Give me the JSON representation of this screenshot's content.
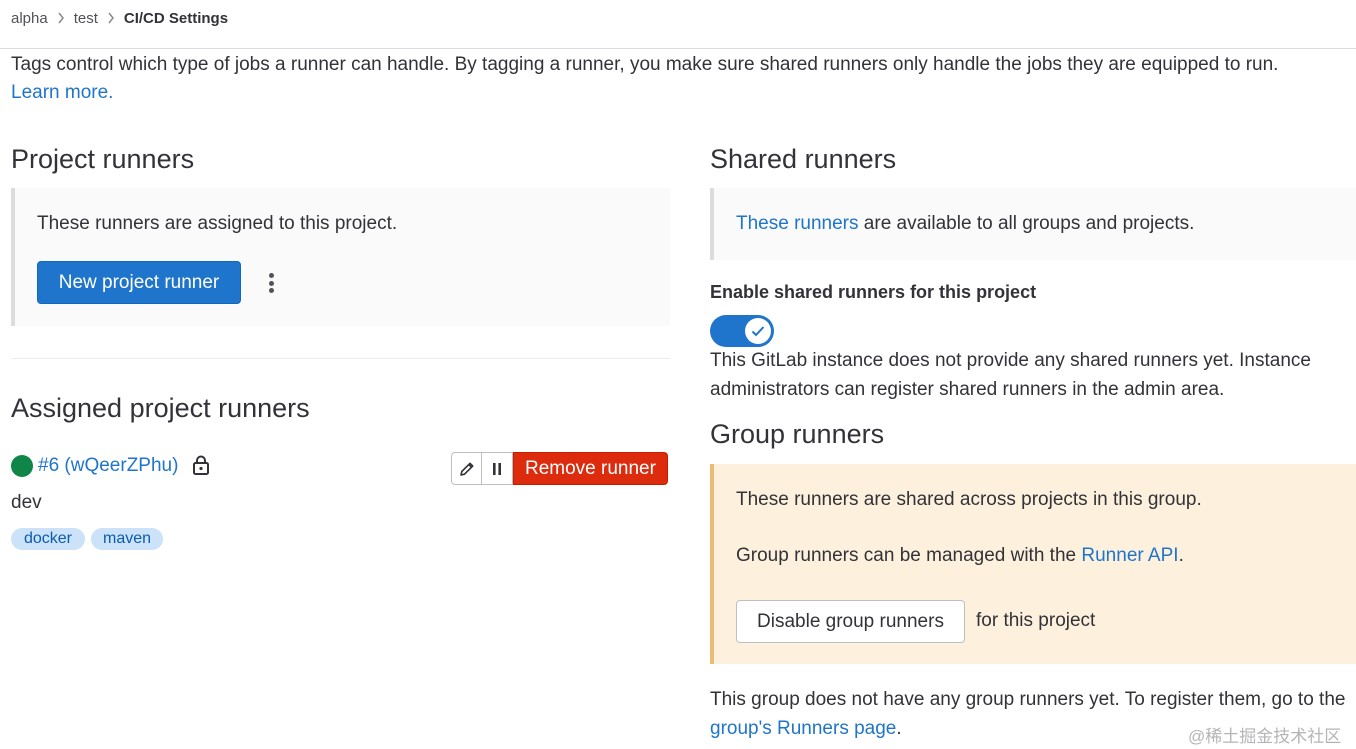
{
  "breadcrumb": {
    "items": [
      "alpha",
      "test"
    ],
    "current": "CI/CD Settings"
  },
  "intro": {
    "text": "Tags control which type of jobs a runner can handle. By tagging a runner, you make sure shared runners only handle the jobs they are equipped to run.",
    "link": "Learn more."
  },
  "project_runners": {
    "title": "Project runners",
    "panel_text": "These runners are assigned to this project.",
    "new_button": "New project runner"
  },
  "assigned": {
    "title": "Assigned project runners",
    "runner": {
      "name": "#6 (wQeerZPhu)",
      "description": "dev",
      "tags": [
        "docker",
        "maven"
      ],
      "status_color": "#108548",
      "remove_label": "Remove runner"
    }
  },
  "shared_runners": {
    "title": "Shared runners",
    "panel_link": "These runners",
    "panel_text": "are available to all groups and projects.",
    "toggle_label": "Enable shared runners for this project",
    "toggle_on": true,
    "note": "This GitLab instance does not provide any shared runners yet. Instance administrators can register shared runners in the admin area."
  },
  "group_runners": {
    "title": "Group runners",
    "line1": "These runners are shared across projects in this group.",
    "line2_prefix": "Group runners can be managed with the",
    "line2_link": "Runner API",
    "line2_suffix": ".",
    "disable_button": "Disable group runners",
    "disable_suffix": "for this project",
    "footer_prefix": "This group does not have any group runners yet. To register them, go to the",
    "footer_link": "group's Runners page",
    "footer_suffix": "."
  },
  "watermark": "@稀土掘金技术社区",
  "colors": {
    "primary": "#1f75cb",
    "danger": "#dd2b0e",
    "success": "#108548",
    "tag_bg": "#cbe2f9",
    "warning_bg": "#fdf1dd"
  }
}
